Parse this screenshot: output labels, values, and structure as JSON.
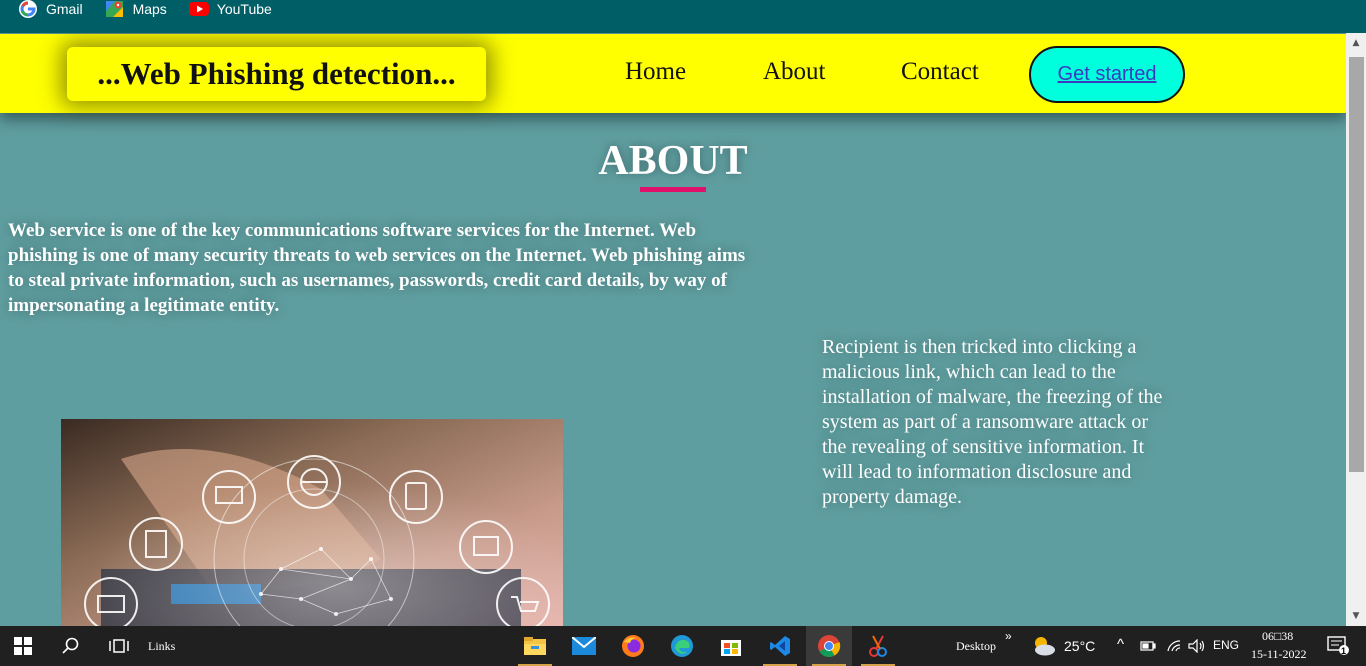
{
  "bookmarks": [
    {
      "label": "Gmail",
      "icon": "google-icon"
    },
    {
      "label": "Maps",
      "icon": "maps-icon"
    },
    {
      "label": "YouTube",
      "icon": "youtube-icon"
    }
  ],
  "nav": {
    "brand": "...Web Phishing detection...",
    "links": [
      "Home",
      "About",
      "Contact"
    ],
    "cta": "Get started"
  },
  "about": {
    "title": "ABOUT",
    "intro": "Web service is one of the key communications software services for the Internet. Web phishing is one of many security threats to web services on the Internet. Web phishing aims to steal private information, such as usernames, passwords, credit card details, by way of impersonating a legitimate entity.",
    "side": "Recipient is then tricked into clicking a malicious link, which can lead to the installation of malware, the freezing of the system as part of a ransomware attack or the revealing of sensitive information. It will lead to information disclosure and property damage."
  },
  "taskbar": {
    "links_label": "Links",
    "desktop_label": "Desktop",
    "chevrons": "»",
    "temperature": "25°C",
    "language": "ENG",
    "time": "06□38",
    "date": "15-11-2022",
    "notification_count": "1"
  },
  "colors": {
    "bookmarks_bg": "#005f66",
    "page_bg": "#5f9ea0",
    "nav_bg": "#ffff00",
    "cta_bg": "#00ffdd",
    "underline": "#e0116a",
    "taskbar_bg": "#202020"
  }
}
